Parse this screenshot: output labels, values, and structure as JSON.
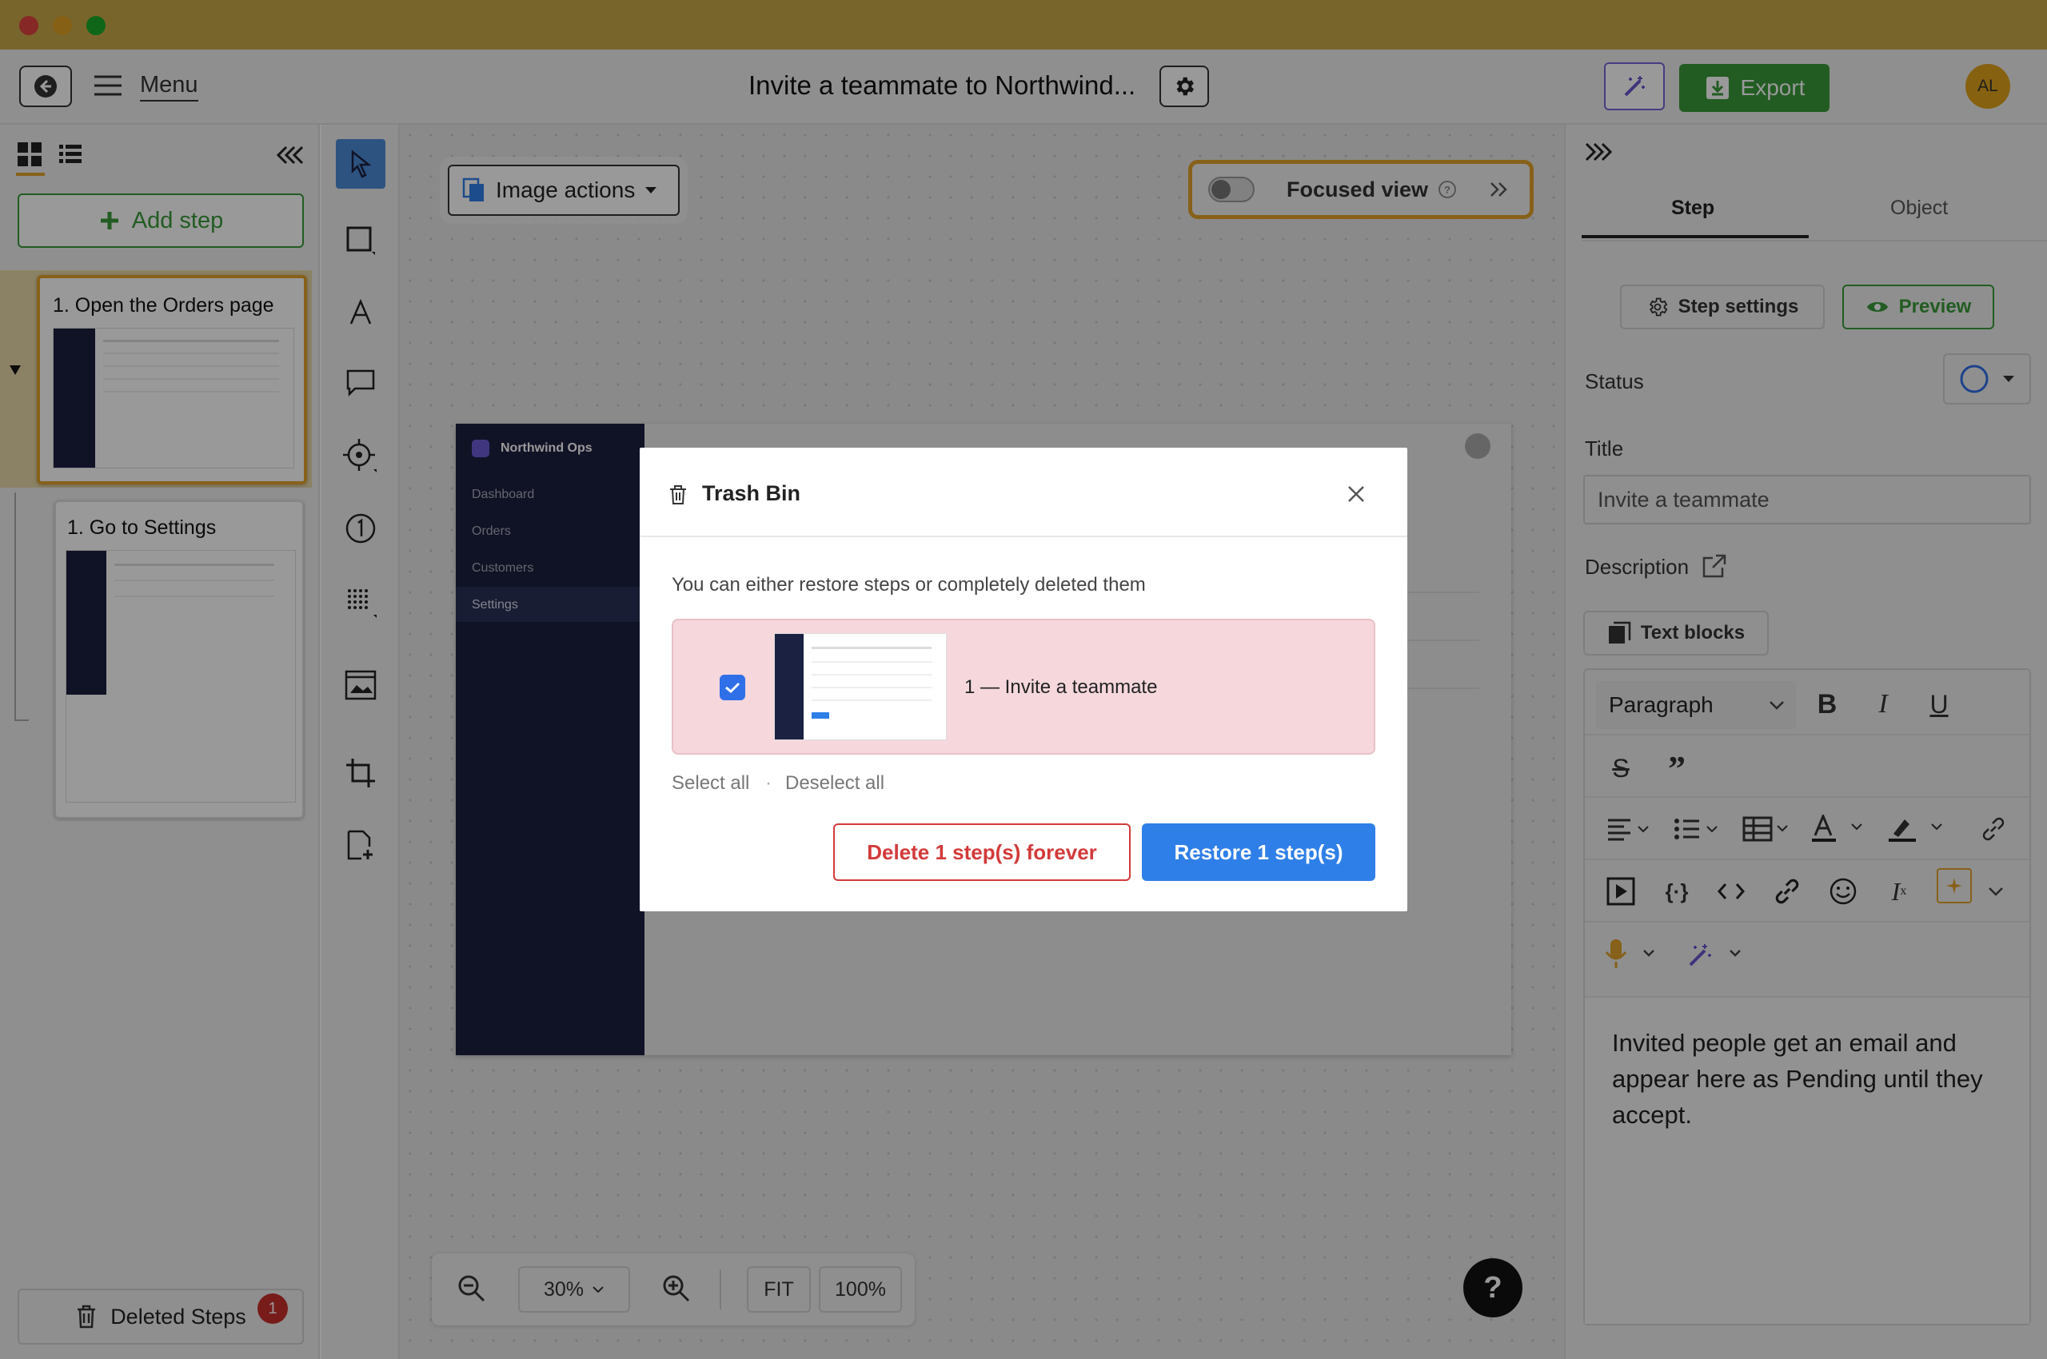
{
  "window": {
    "close_color": "#e0443e",
    "min_color": "#dea123",
    "max_color": "#1aab29"
  },
  "toolbar": {
    "menu_label": "Menu",
    "doc_title": "Invite a teammate to Northwind...",
    "export_label": "Export",
    "avatar_initials": "AL"
  },
  "left_panel": {
    "add_step_label": "Add step",
    "steps": [
      {
        "title": "1. Open the Orders page",
        "selected": true
      },
      {
        "title": "1. Go to Settings",
        "selected": false
      }
    ],
    "deleted_steps_label": "Deleted Steps",
    "deleted_count": "1"
  },
  "canvas": {
    "image_actions_label": "Image actions",
    "focused_view_label": "Focused view",
    "zoom_value": "30%",
    "fit_label": "FIT",
    "hundred_label": "100%",
    "help_label": "?"
  },
  "screenshot": {
    "app_name": "Northwind Ops",
    "nav": [
      "Dashboard",
      "Orders",
      "Customers",
      "Settings"
    ]
  },
  "modal": {
    "title": "Trash Bin",
    "description": "You can either restore steps or completely deleted them",
    "item_label": "1 — Invite a teammate",
    "select_all": "Select all",
    "separator": "·",
    "deselect_all": "Deselect all",
    "delete_label": "Delete 1 step(s) forever",
    "restore_label": "Restore 1 step(s)"
  },
  "right_panel": {
    "tabs": [
      "Step",
      "Object"
    ],
    "step_settings_label": "Step settings",
    "preview_label": "Preview",
    "status_label": "Status",
    "title_label": "Title",
    "title_value": "Invite a teammate",
    "description_label": "Description",
    "text_blocks_label": "Text blocks",
    "paragraph_select": "Paragraph",
    "editor_text": "Invited people get an email and appear here as Pending until they accept."
  },
  "colors": {
    "accent_green": "#3a9a3a",
    "accent_blue": "#2f7fe8",
    "danger_red": "#d33a3a",
    "highlight_orange": "#e2a22a"
  }
}
